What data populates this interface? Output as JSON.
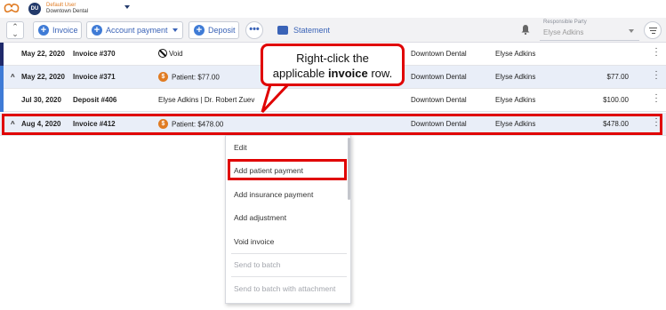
{
  "header": {
    "avatar_initials": "DU",
    "user_name": "Default User",
    "practice": "Downtown Dental"
  },
  "toolbar": {
    "invoice_label": "Invoice",
    "account_payment_label": "Account payment",
    "deposit_label": "Deposit",
    "more_label": "•••",
    "statement_label": "Statement",
    "responsible_party_label": "Responsible Party",
    "responsible_party_value": "Elyse Adkins"
  },
  "rows": [
    {
      "chevron": "",
      "date": "May 22, 2020",
      "doc": "Invoice #370",
      "desc": "Void",
      "practice": "Downtown Dental",
      "responsible": "Elyse Adkins",
      "amount": ""
    },
    {
      "chevron": "^",
      "date": "May 22, 2020",
      "doc": "Invoice #371",
      "desc": "Patient: $77.00",
      "practice": "Downtown Dental",
      "responsible": "Elyse Adkins",
      "amount": "$77.00"
    },
    {
      "chevron": "",
      "date": "Jul 30, 2020",
      "doc": "Deposit #406",
      "desc": "Elyse Adkins | Dr. Robert Zuev",
      "practice": "Downtown Dental",
      "responsible": "Elyse Adkins",
      "amount": "$100.00"
    },
    {
      "chevron": "^",
      "date": "Aug 4, 2020",
      "doc": "Invoice #412",
      "desc": "Patient: $478.00",
      "practice": "Downtown Dental",
      "responsible": "Elyse Adkins",
      "amount": "$478.00"
    }
  ],
  "callout": {
    "line1": "Right-click the",
    "line2_prefix": "applicable ",
    "line2_bold": "invoice",
    "line2_suffix": " row."
  },
  "context_menu": {
    "items": [
      "Edit",
      "Add patient payment",
      "Add insurance payment",
      "Add adjustment",
      "Void invoice",
      "Send to batch",
      "Send to batch with attachment"
    ]
  },
  "icons": {
    "dollar": "$"
  },
  "colors": {
    "accent_blue": "#3a63b7",
    "highlight_red": "#e00000",
    "patient_orange": "#e07b22",
    "row_accent_navy": "#1f2a6b"
  }
}
